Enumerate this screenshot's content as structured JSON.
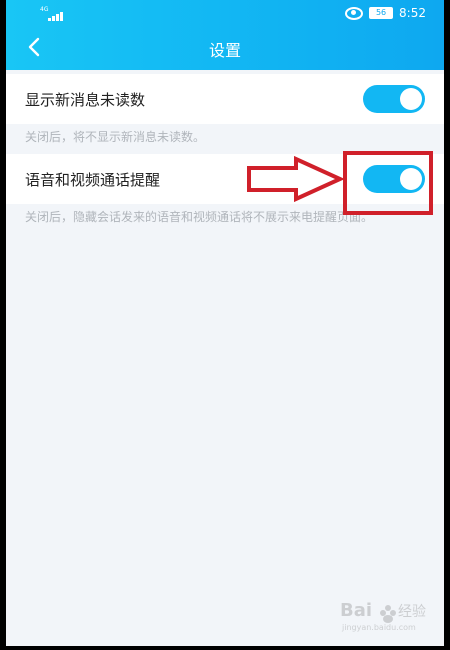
{
  "status_bar": {
    "signal_label": "4G",
    "battery": "56",
    "time": "8:52"
  },
  "header": {
    "title": "设置"
  },
  "settings": [
    {
      "label": "显示新消息未读数",
      "enabled": true,
      "description": "关闭后，将不显示新消息未读数。"
    },
    {
      "label": "语音和视频通话提醒",
      "enabled": true,
      "description": "关闭后，隐藏会话发来的语音和视频通话将不展示来电提醒页面。"
    }
  ],
  "colors": {
    "header": "#12b7f3",
    "toggle_on": "#12b7f3",
    "annotation": "#d0202a"
  },
  "watermark": {
    "text": "Baidu经验",
    "url": "jingyan.baidu.com"
  }
}
